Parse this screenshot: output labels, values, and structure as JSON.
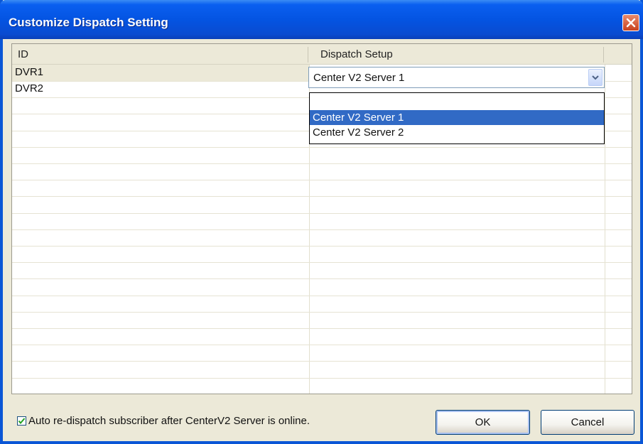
{
  "window": {
    "title": "Customize Dispatch Setting"
  },
  "grid": {
    "columns": [
      "ID",
      "Dispatch Setup"
    ],
    "rows": [
      {
        "id": "DVR1",
        "dispatch": "Center V2 Server 1"
      },
      {
        "id": "DVR2",
        "dispatch": ""
      }
    ]
  },
  "combo": {
    "value": "Center V2 Server 1",
    "options": [
      "",
      "Center V2 Server 1",
      "Center V2 Server 2"
    ],
    "highlighted_option": "Center V2 Server 1"
  },
  "footer": {
    "auto_redispatch_checked": true,
    "auto_redispatch_label": "Auto re-dispatch subscriber after CenterV2 Server is online.",
    "ok_label": "OK",
    "cancel_label": "Cancel"
  },
  "colors": {
    "titlebar": "#0454e2",
    "highlight": "#316ac5",
    "dialog_bg": "#ece9d8"
  }
}
